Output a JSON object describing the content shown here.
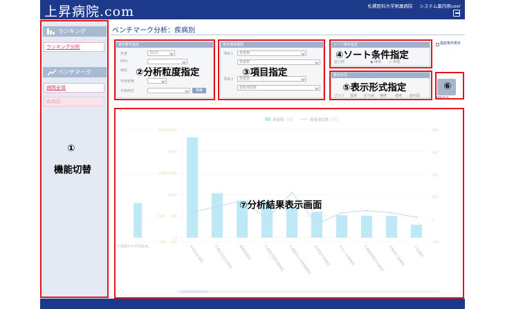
{
  "header": {
    "logo": "上昇病院.com",
    "hospital": "札幌医科大学附属病院",
    "system_user": "システム案内用user"
  },
  "sidebar": {
    "sections": [
      {
        "label": "ランキング",
        "icon": "bar-chart-icon",
        "items": [
          {
            "label": "ランキング分析",
            "active": true
          }
        ]
      },
      {
        "label": "ベンチマーク",
        "icon": "benchmark-icon",
        "items": [
          {
            "label": "病院全体",
            "active": true
          },
          {
            "label": "疾病別",
            "active": false
          }
        ]
      }
    ]
  },
  "page": {
    "title": "ベンチマーク分析：疾病別"
  },
  "filter_panel": {
    "header": "表示条件指定",
    "rows": [
      {
        "label": "年度",
        "value": "2013"
      },
      {
        "label": "MDC",
        "value": ""
      },
      {
        "label": "病名",
        "value": ""
      },
      {
        "label": "手術有無",
        "value": ""
      },
      {
        "label": "手術術式",
        "value": ""
      }
    ],
    "search_button": "検索"
  },
  "item_panel": {
    "header": "表示項目選択",
    "rows": [
      {
        "label": "項目１",
        "value": "患者数"
      },
      {
        "label": "",
        "value": "患者数"
      },
      {
        "label": "項目２",
        "value": "患者数"
      },
      {
        "label": "",
        "value": "患者増加数"
      }
    ]
  },
  "sort_panel": {
    "header": "ソート条件設定",
    "row_label": "並び順",
    "options": [
      "降順",
      "昇順"
    ],
    "selected": "降順"
  },
  "display_panel": {
    "header": "表示形式",
    "options": [
      "グラフ",
      "縦棒",
      "折れ線",
      "横棒",
      "積棒",
      "散布図"
    ]
  },
  "options": {
    "checkbox_label": "指定条件表示",
    "print_label": "PDF出力"
  },
  "callouts": [
    {
      "num": "①",
      "label": "機能切替"
    },
    {
      "num": "②",
      "label": "分析粒度指定"
    },
    {
      "num": "③",
      "label": "項目指定"
    },
    {
      "num": "④",
      "label": "ソート条件指定"
    },
    {
      "num": "⑤",
      "label": "表示形式指定"
    },
    {
      "num": "⑥",
      "label": ""
    },
    {
      "num": "⑦",
      "label": "分析結果表示画面"
    }
  ],
  "chart_data": {
    "type": "bar",
    "legend": [
      "患者数（人）",
      "患者増加数（人）"
    ],
    "left_chart": {
      "categories": [
        "札幌医科大学附属病..."
      ],
      "bar": [
        800
      ],
      "line": [
        10
      ],
      "y_ticks": [
        "2500",
        "1500",
        "500",
        "-100"
      ]
    },
    "categories": [
      "中村記念病院",
      "札幌白石記念病院",
      "勤医協病院",
      "札幌孤児院附属病院",
      "札幌医科大学附属病院",
      "北海道大学病院",
      "かわい札幌病院",
      "札幌脳神経外科病院",
      "手稲渓仁会病院",
      "江別病院"
    ],
    "series": [
      {
        "name": "患者数（人）",
        "values": [
          2330,
          1030,
          860,
          850,
          720,
          600,
          520,
          510,
          500,
          300
        ]
      },
      {
        "name": "患者増加数（人）",
        "values": [
          30,
          60,
          80,
          5,
          120,
          -20,
          30,
          40,
          30,
          10
        ]
      }
    ],
    "left_axis_ticks": [
      "2500",
      "2000",
      "1500",
      "1000",
      "500",
      "0",
      "-100"
    ],
    "right_axis_ticks": [
      "400",
      "300",
      "200",
      "100",
      "0",
      "-100"
    ],
    "ylim": [
      -100,
      2500
    ],
    "y2lim": [
      -100,
      400
    ]
  }
}
